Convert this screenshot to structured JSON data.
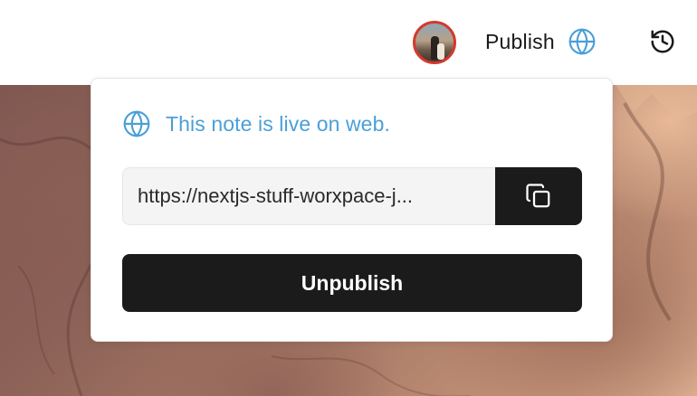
{
  "topbar": {
    "publish_label": "Publish"
  },
  "popover": {
    "status_text": "This note is live on web.",
    "url_value": "https://nextjs-stuff-worxpace-j...",
    "unpublish_label": "Unpublish"
  },
  "icons": {
    "globe": "globe-icon",
    "history": "history-icon",
    "copy": "copy-icon",
    "avatar": "user-avatar"
  },
  "colors": {
    "accent": "#4a9fd8",
    "button_dark": "#1b1b1b",
    "avatar_ring": "#d23a2e"
  }
}
